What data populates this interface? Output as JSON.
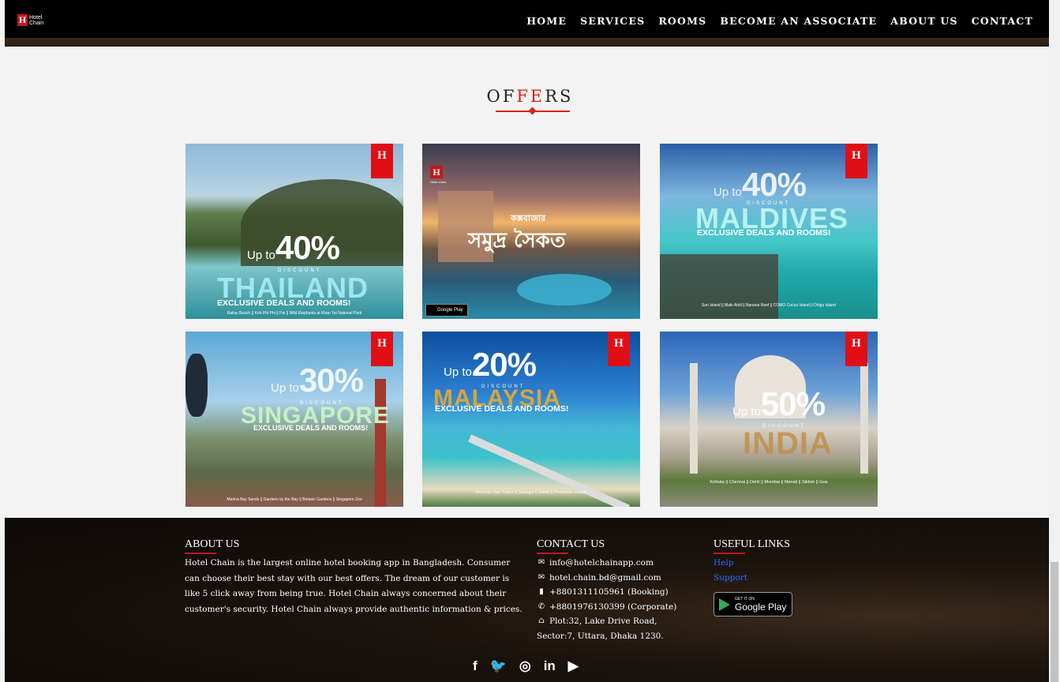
{
  "nav": {
    "logo_line1": "Hotel",
    "logo_line2": "Chain",
    "logo_mark": "H",
    "items": [
      "HOME",
      "SERVICES",
      "ROOMS",
      "BECOME AN ASSOCIATE",
      "ABOUT US",
      "CONTACT"
    ]
  },
  "offers": {
    "title_a": "OF",
    "title_b": "FE",
    "title_c": "RS",
    "badge_mark": "H",
    "cards": [
      {
        "upto_label": "Up to",
        "percent": "40%",
        "discount": "DISCOUNT",
        "destination": "THAILAND",
        "exclusive": "EXCLUSIVE DEALS AND ROOMS!",
        "places": "Railay Beach || Koh Phi Phi || Pai || Wild Elephants at Khao Yai National Park"
      },
      {
        "headline_top": "কক্সবাজার",
        "headline_main": "সমুদ্র সৈকত",
        "brand": "Hotel chain",
        "store": "Google Play"
      },
      {
        "upto_label": "Up to",
        "percent": "40%",
        "discount": "DISCOUNT",
        "destination": "MALDIVES",
        "exclusive": "EXCLUSIVE DEALS AND ROOMS!",
        "places": "Sun Island || Male Atoll || Banana Reef || COMO Cocoa Island || Dhigu Island"
      },
      {
        "upto_label": "Up to",
        "percent": "30%",
        "discount": "DISCOUNT",
        "destination": "SINGAPORE",
        "exclusive": "EXCLUSIVE DEALS AND ROOMS!",
        "places": "Marina Bay Sands || Gardens by the Bay || Botanic Gardens || Singapore Zoo"
      },
      {
        "upto_label": "Up to",
        "percent": "20%",
        "discount": "DISCOUNT",
        "destination": "MALAYSIA",
        "exclusive": "EXCLUSIVE DEALS AND ROOMS!",
        "places": "Petronas Twin Towers || Selangor || Sabah || Perhentian Islands"
      },
      {
        "upto_label": "Up to",
        "percent": "50%",
        "discount": "DISCOUNT",
        "destination": "INDIA",
        "exclusive": "",
        "places": "Kolkata || Chennai || Dehli || Mumbai || Manali || Sikkim || Goa"
      }
    ]
  },
  "footer": {
    "about_heading": "ABOUT US",
    "about_text": "Hotel Chain is the largest online hotel booking app in Bangladesh. Consumer can choose their best stay with our best offers. The dream of our customer is like 5 click away from being true. Hotel Chain always concerned about their customer's security. Hotel Chain always provide authentic information & prices.",
    "contact_heading": "CONTACT US",
    "email1": "info@hotelchainapp.com",
    "email2": "hotel.chain.bd@gmail.com",
    "phone_booking": "+8801311105961 (Booking)",
    "phone_corporate": "+8801976130399 (Corporate)",
    "address_line1": "Plot:32, Lake Drive Road,",
    "address_line2": "Sector:7, Uttara, Dhaka 1230.",
    "links_heading": "USEFUL LINKS",
    "help_link": "Help",
    "support_link": "Support",
    "gplay_small": "GET IT ON",
    "gplay_big": "Google Play",
    "social": [
      "f",
      "🐦",
      "◎",
      "in",
      "▶"
    ]
  },
  "colors": {
    "accent": "#d9231d",
    "badge": "#e00f16",
    "link": "#2f6bff"
  }
}
